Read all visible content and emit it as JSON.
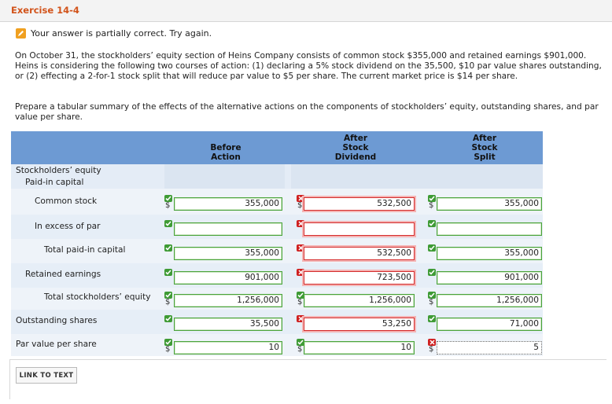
{
  "exercise_title": "Exercise 14-4",
  "status_message": "Your answer is partially correct.  Try again.",
  "problem_text": "On October 31, the stockholders’ equity section of Heins Company consists of common stock $355,000 and retained earnings $901,000. Heins is considering the following two courses of action: (1) declaring a 5% stock dividend on the 35,500, $10 par value shares outstanding, or (2) effecting a 2-for-1 stock split that will reduce par value to $5 per share. The current market price is $14 per share.",
  "instruction_text": "Prepare a tabular summary of the effects of the alternative actions on the components of stockholders’ equity, outstanding shares, and par value per share.",
  "columns": {
    "before": [
      "Before",
      "Action"
    ],
    "dividend": [
      "After",
      "Stock",
      "Dividend"
    ],
    "split": [
      "After",
      "Stock",
      "Split"
    ]
  },
  "labels": {
    "se": "Stockholders’ equity",
    "pic": "Paid-in capital",
    "cs": "Common stock",
    "iep": "In excess of par",
    "tpic": "Total paid-in capital",
    "re": "Retained earnings",
    "tse": "Total stockholders’ equity",
    "os": "Outstanding shares",
    "pv": "Par value per share"
  },
  "currency_symbol": "$",
  "values": {
    "cs": [
      "355,000",
      "532,500",
      "355,000"
    ],
    "iep": [
      "",
      "",
      ""
    ],
    "tpic": [
      "355,000",
      "532,500",
      "355,000"
    ],
    "re": [
      "901,000",
      "723,500",
      "901,000"
    ],
    "tse": [
      "1,256,000",
      "1,256,000",
      "1,256,000"
    ],
    "os": [
      "35,500",
      "53,250",
      "71,000"
    ],
    "pv": [
      "10",
      "10",
      "5"
    ]
  },
  "field_status": {
    "cs": [
      "correct",
      "incorrect",
      "correct"
    ],
    "iep": [
      "correct",
      "incorrect",
      "correct"
    ],
    "tpic": [
      "correct",
      "incorrect",
      "correct"
    ],
    "re": [
      "correct",
      "incorrect",
      "correct"
    ],
    "tse": [
      "correct",
      "correct",
      "correct"
    ],
    "os": [
      "correct",
      "incorrect",
      "correct"
    ],
    "pv": [
      "correct",
      "correct",
      "incorrect"
    ]
  },
  "link_button": "LINK TO TEXT",
  "colors": {
    "header": "#6d9ad3",
    "correct": "#3f9b35",
    "incorrect": "#cf2020",
    "title": "#d2531a"
  }
}
